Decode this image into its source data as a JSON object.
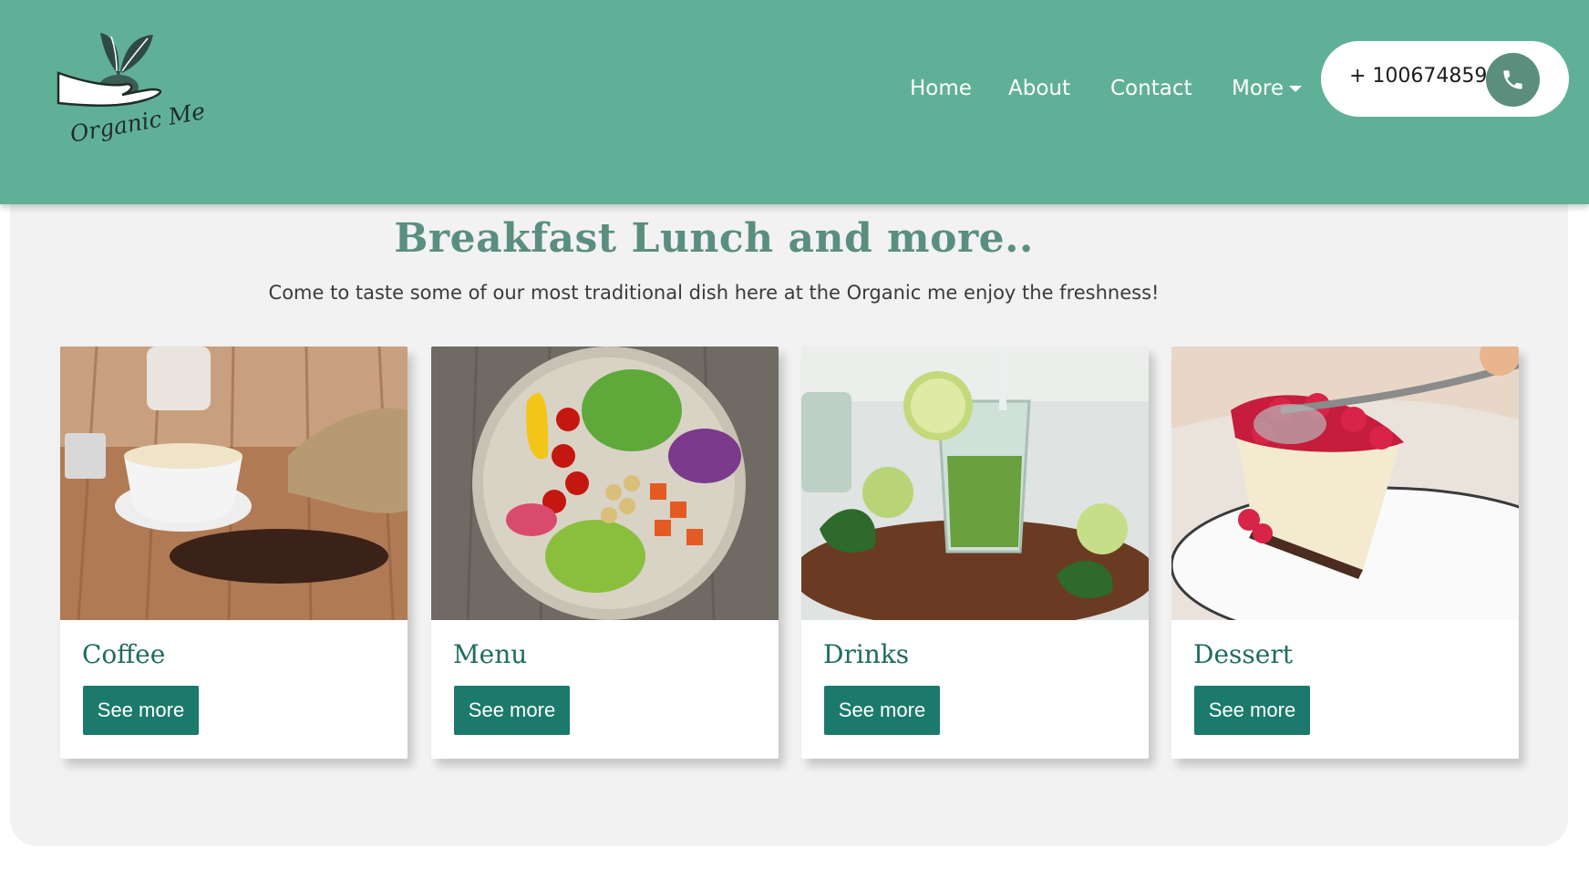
{
  "brand": {
    "name": "Organic Me"
  },
  "nav": {
    "items": [
      {
        "label": "Home"
      },
      {
        "label": "About"
      },
      {
        "label": "Contact"
      },
      {
        "label": "More"
      }
    ]
  },
  "phone": {
    "number": "+ 100674859",
    "icon": "phone-icon"
  },
  "hero": {
    "title": "Breakfast Lunch and more..",
    "subtitle": "Come to taste some of our most traditional dish here at the Organic me enjoy the freshness!"
  },
  "cards": [
    {
      "title": "Coffee",
      "button": "See more",
      "image": "coffee-image"
    },
    {
      "title": "Menu",
      "button": "See more",
      "image": "salad-bowl-image"
    },
    {
      "title": "Drinks",
      "button": "See more",
      "image": "mojito-drink-image"
    },
    {
      "title": "Dessert",
      "button": "See more",
      "image": "cheesecake-image"
    }
  ],
  "colors": {
    "header": "#60b097",
    "accent": "#1b7a6b",
    "title_text": "#5a8e81",
    "phone_button": "#5b8e7d"
  }
}
